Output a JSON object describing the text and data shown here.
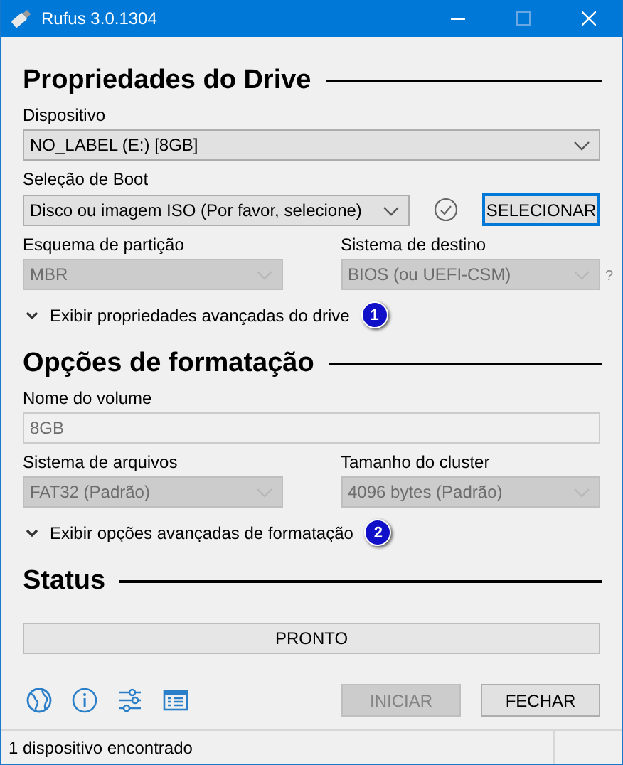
{
  "window": {
    "title": "Rufus 3.0.1304"
  },
  "sections": [
    {
      "heading": "Propriedades do Drive",
      "rows": [
        [
          {
            "kind": "select",
            "label": "Dispositivo",
            "value": "NO_LABEL (E:) [8GB]",
            "disabled": false
          }
        ],
        [
          {
            "kind": "select",
            "label": "Seleção de Boot",
            "value": "Disco ou imagem ISO (Por favor, selecione)",
            "disabled": false,
            "check": true,
            "button": "SELECIONAR"
          }
        ],
        [
          {
            "kind": "select",
            "label": "Esquema de partição",
            "value": "MBR",
            "disabled": true
          },
          {
            "kind": "select",
            "label": "Sistema de destino",
            "value": "BIOS (ou UEFI-CSM)",
            "disabled": true,
            "help": "?"
          }
        ]
      ],
      "expander": {
        "label": "Exibir propriedades avançadas do drive",
        "expanded": false,
        "badge": "1"
      }
    },
    {
      "heading": "Opções de formatação",
      "rows": [
        [
          {
            "kind": "text",
            "label": "Nome do volume",
            "value": "8GB",
            "disabled": true
          }
        ],
        [
          {
            "kind": "select",
            "label": "Sistema de arquivos",
            "value": "FAT32 (Padrão)",
            "disabled": true
          },
          {
            "kind": "select",
            "label": "Tamanho do cluster",
            "value": "4096 bytes (Padrão)",
            "disabled": true
          }
        ]
      ],
      "expander": {
        "label": "Exibir opções avançadas de formatação",
        "expanded": false,
        "badge": "2"
      }
    },
    {
      "heading": "Status",
      "progress": {
        "text": "PRONTO",
        "level": 0
      }
    }
  ],
  "toolbar": [
    {
      "kind": "globe"
    },
    {
      "kind": "info"
    },
    {
      "kind": "settings"
    },
    {
      "kind": "log"
    }
  ],
  "buttons": [
    {
      "label": "INICIAR",
      "disabled": true
    },
    {
      "label": "FECHAR",
      "disabled": false
    }
  ],
  "status_bar": {
    "text": "1 dispositivo encontrado"
  }
}
